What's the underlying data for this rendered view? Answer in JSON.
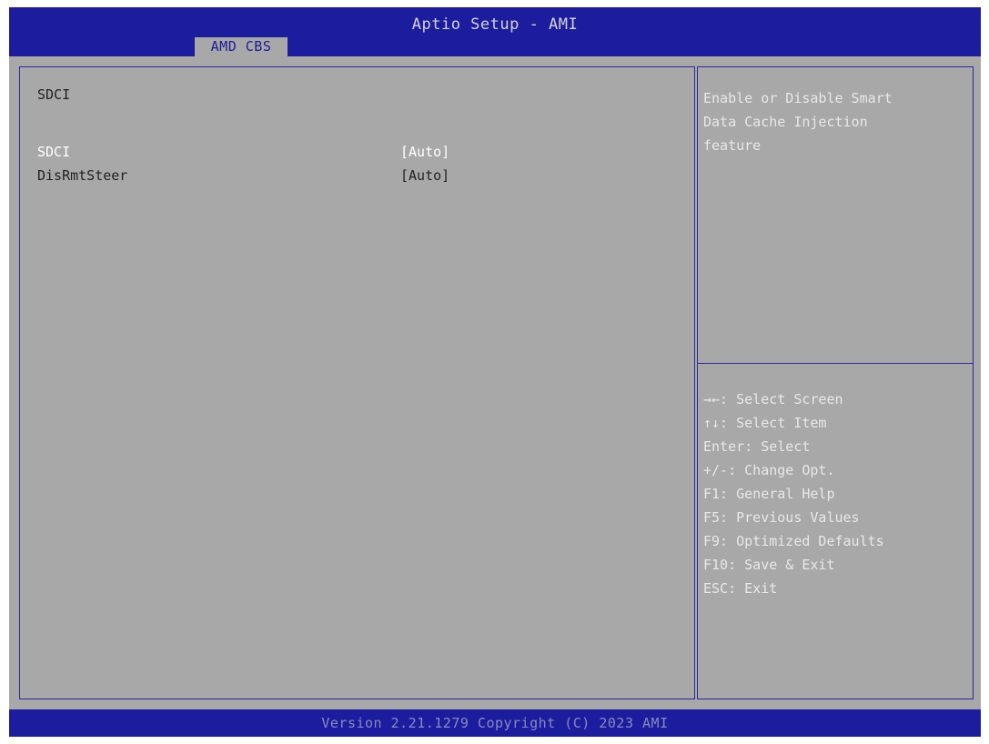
{
  "header": {
    "title": "Aptio Setup - AMI",
    "tab": "AMD CBS"
  },
  "main": {
    "section_title": "SDCI",
    "settings": [
      {
        "label": "SDCI",
        "value": "[Auto]",
        "selected": true
      },
      {
        "label": "DisRmtSteer",
        "value": "[Auto]",
        "selected": false
      }
    ]
  },
  "help": {
    "description": "Enable or Disable Smart\nData Cache Injection\nfeature",
    "keys": [
      "→←: Select Screen",
      "↑↓: Select Item",
      "Enter: Select",
      "+/-: Change Opt.",
      "F1: General Help",
      "F5: Previous Values",
      "F9: Optimized Defaults",
      "F10: Save & Exit",
      "ESC: Exit"
    ]
  },
  "footer": {
    "version": "Version 2.21.1279 Copyright (C) 2023 AMI"
  },
  "colors": {
    "header_bg": "#1c1c9e",
    "screen_bg": "#a8a8a8",
    "selected_text": "#ffffff",
    "help_text": "#e8e8e8"
  }
}
